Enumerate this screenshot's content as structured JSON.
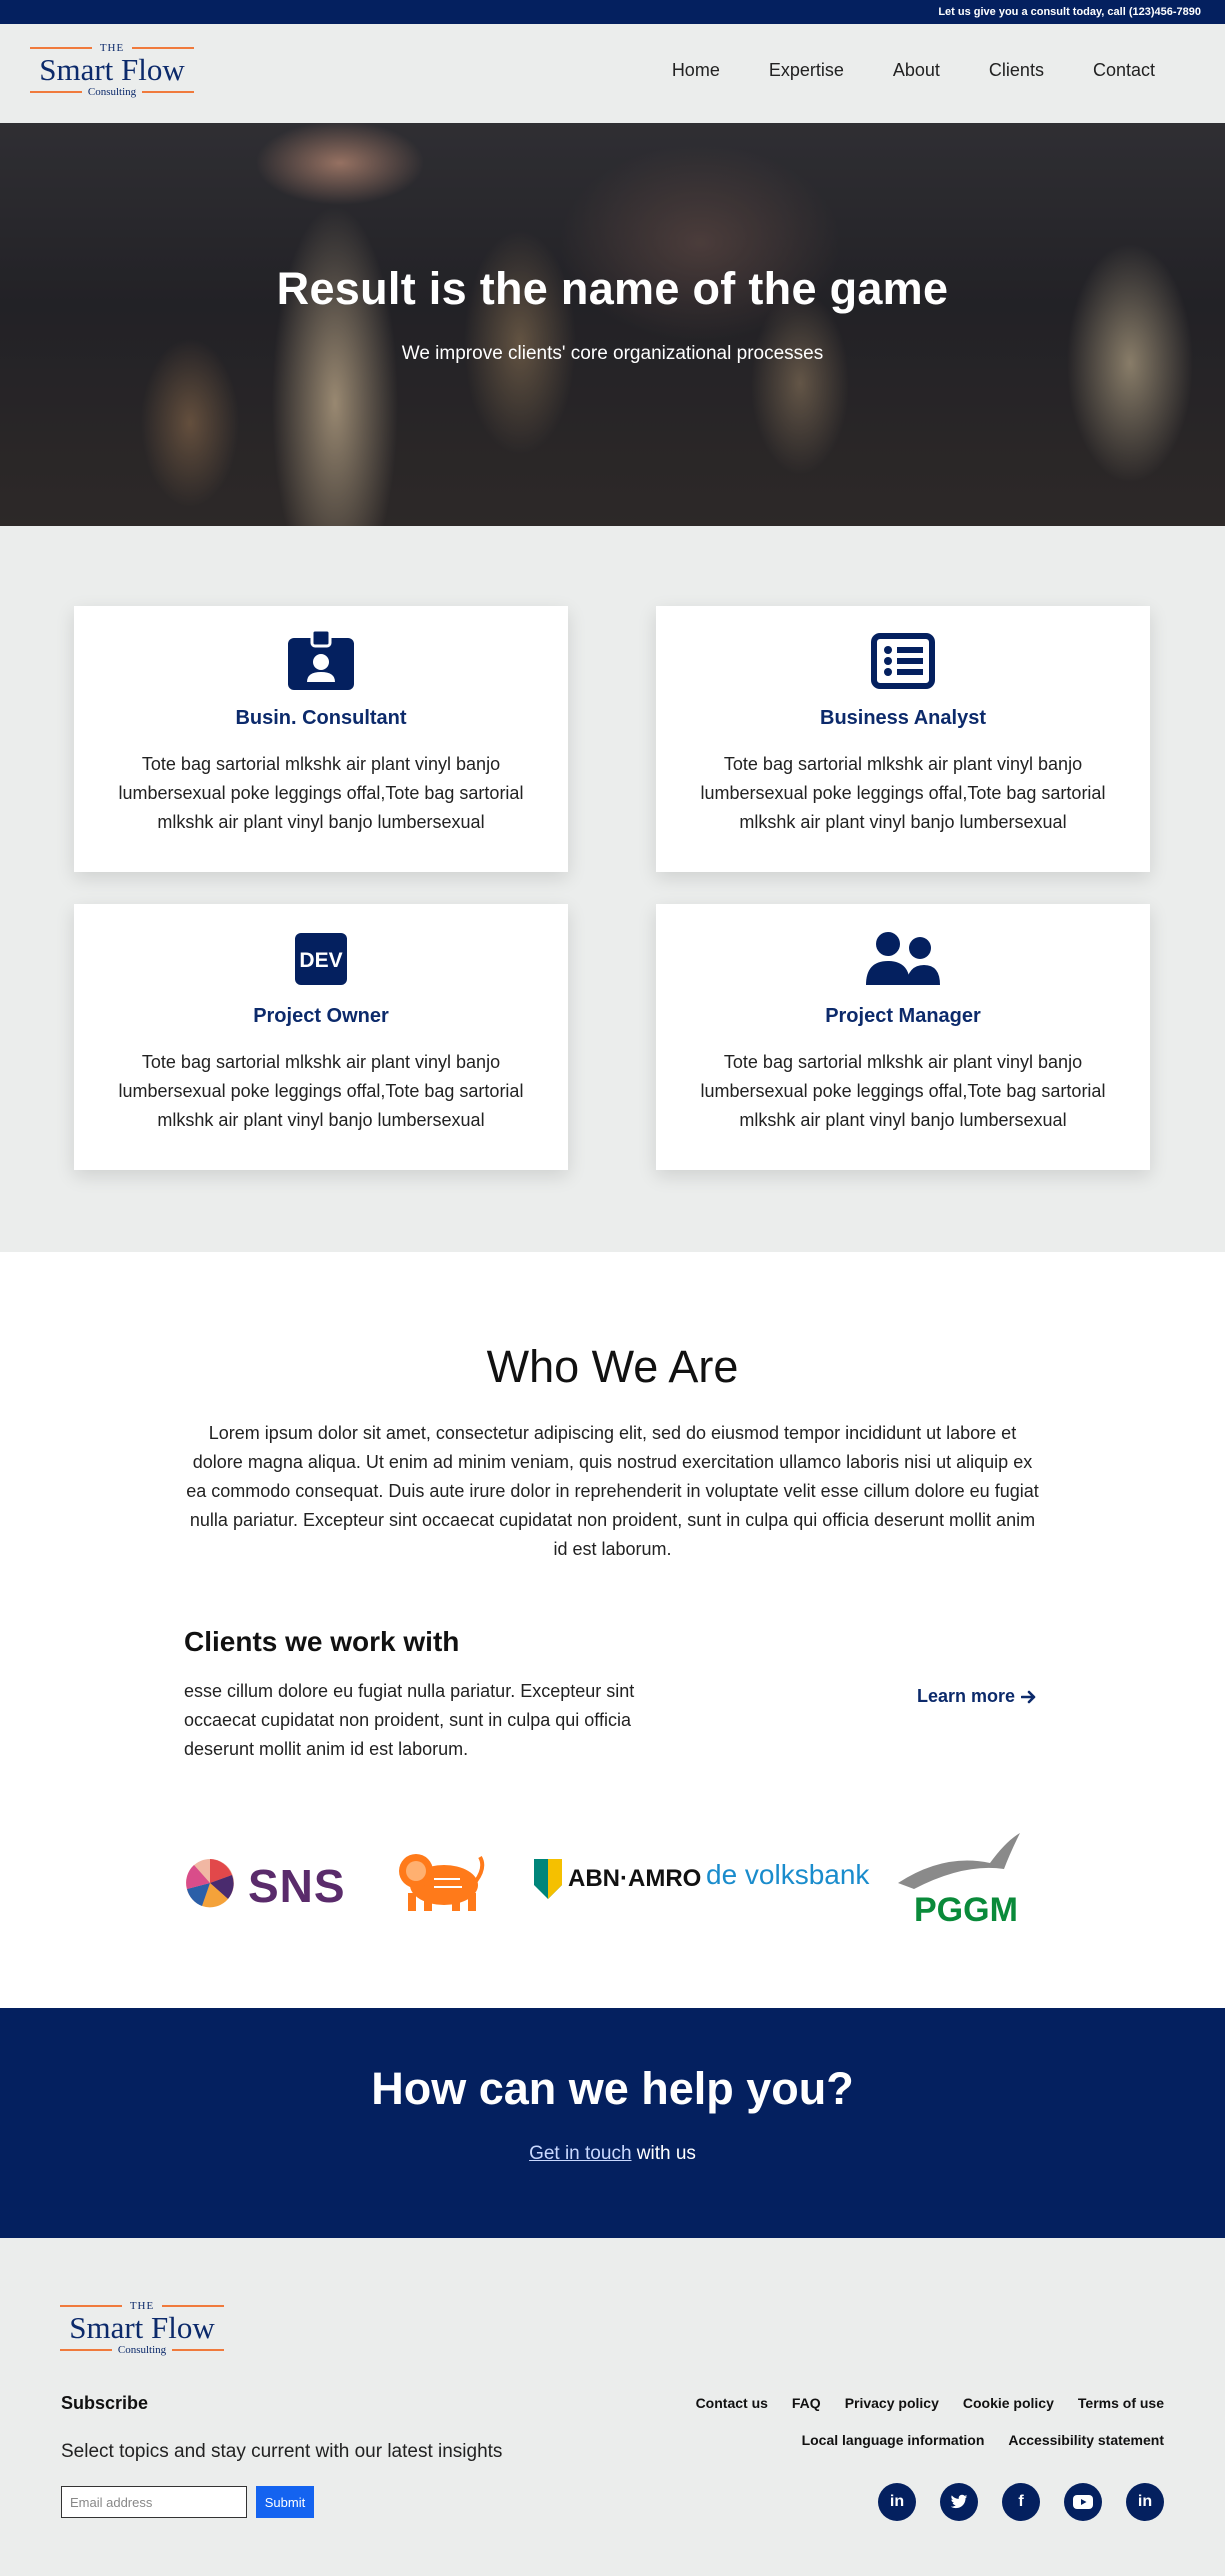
{
  "topbar": {
    "text": "Let us give you a consult today, call (123)456-7890"
  },
  "logo": {
    "the": "THE",
    "name": "Smart Flow",
    "sub": "Consulting"
  },
  "nav": {
    "items": [
      "Home",
      "Expertise",
      "About",
      "Clients",
      "Contact"
    ]
  },
  "hero": {
    "title": "Result is the name of the game",
    "subtitle": "We improve clients' core organizational processes"
  },
  "services": [
    {
      "icon": "id-badge-icon",
      "title": "Busin. Consultant",
      "text": "Tote bag sartorial mlkshk air plant vinyl banjo lumbersexual poke leggings offal,Tote bag sartorial mlkshk air plant vinyl banjo lumbersexual"
    },
    {
      "icon": "list-alt-icon",
      "title": "Business Analyst",
      "text": "Tote bag sartorial mlkshk air plant vinyl banjo lumbersexual poke leggings offal,Tote bag sartorial mlkshk air plant vinyl banjo lumbersexual"
    },
    {
      "icon": "dev-icon",
      "title": "Project Owner",
      "text": "Tote bag sartorial mlkshk air plant vinyl banjo lumbersexual poke leggings offal,Tote bag sartorial mlkshk air plant vinyl banjo lumbersexual"
    },
    {
      "icon": "users-icon",
      "title": "Project Manager",
      "text": "Tote bag sartorial mlkshk air plant vinyl banjo lumbersexual poke leggings offal,Tote bag sartorial mlkshk air plant vinyl banjo lumbersexual"
    }
  ],
  "who": {
    "title": "Who We Are",
    "text": "Lorem ipsum dolor sit amet, consectetur adipiscing elit, sed do eiusmod tempor incididunt ut labore et dolore magna aliqua. Ut enim ad minim veniam, quis nostrud exercitation ullamco laboris nisi ut aliquip ex ea commodo consequat. Duis aute irure dolor in reprehenderit in voluptate velit esse cillum dolore eu fugiat nulla pariatur. Excepteur sint occaecat cupidatat non proident, sunt in culpa qui officia deserunt mollit anim id est laborum."
  },
  "clients": {
    "title": "Clients we work with",
    "text": "esse cillum dolore eu fugiat nulla pariatur. Excepteur sint occaecat cupidatat non proident, sunt in culpa qui officia deserunt mollit anim id est laborum.",
    "learn_more": "Learn more",
    "logos": {
      "sns": "SNS",
      "abn": "ABN·AMRO",
      "volksbank": "de volksbank",
      "pggm": "PGGM"
    }
  },
  "cta": {
    "title": "How can we help you?",
    "link": "Get in touch",
    "suffix": " with us"
  },
  "footer": {
    "subscribe_title": "Subscribe",
    "subscribe_text": "Select topics and stay current with our latest insights",
    "email_placeholder": "Email address",
    "submit": "Submit",
    "links_row1": [
      "Contact us",
      "FAQ",
      "Privacy policy",
      "Cookie policy",
      "Terms of use"
    ],
    "links_row2": [
      "Local language information",
      "Accessibility statement"
    ],
    "socials": [
      {
        "icon": "linkedin-icon",
        "glyph": "in"
      },
      {
        "icon": "twitter-icon",
        "glyph": "t"
      },
      {
        "icon": "facebook-icon",
        "glyph": "f"
      },
      {
        "icon": "youtube-icon",
        "glyph": "▶"
      },
      {
        "icon": "linkedin-icon",
        "glyph": "in"
      }
    ]
  },
  "colors": {
    "navy": "#04205f",
    "brand_blue": "#0c2a6b",
    "orange": "#f07a3c",
    "submit_blue": "#1463f0"
  }
}
